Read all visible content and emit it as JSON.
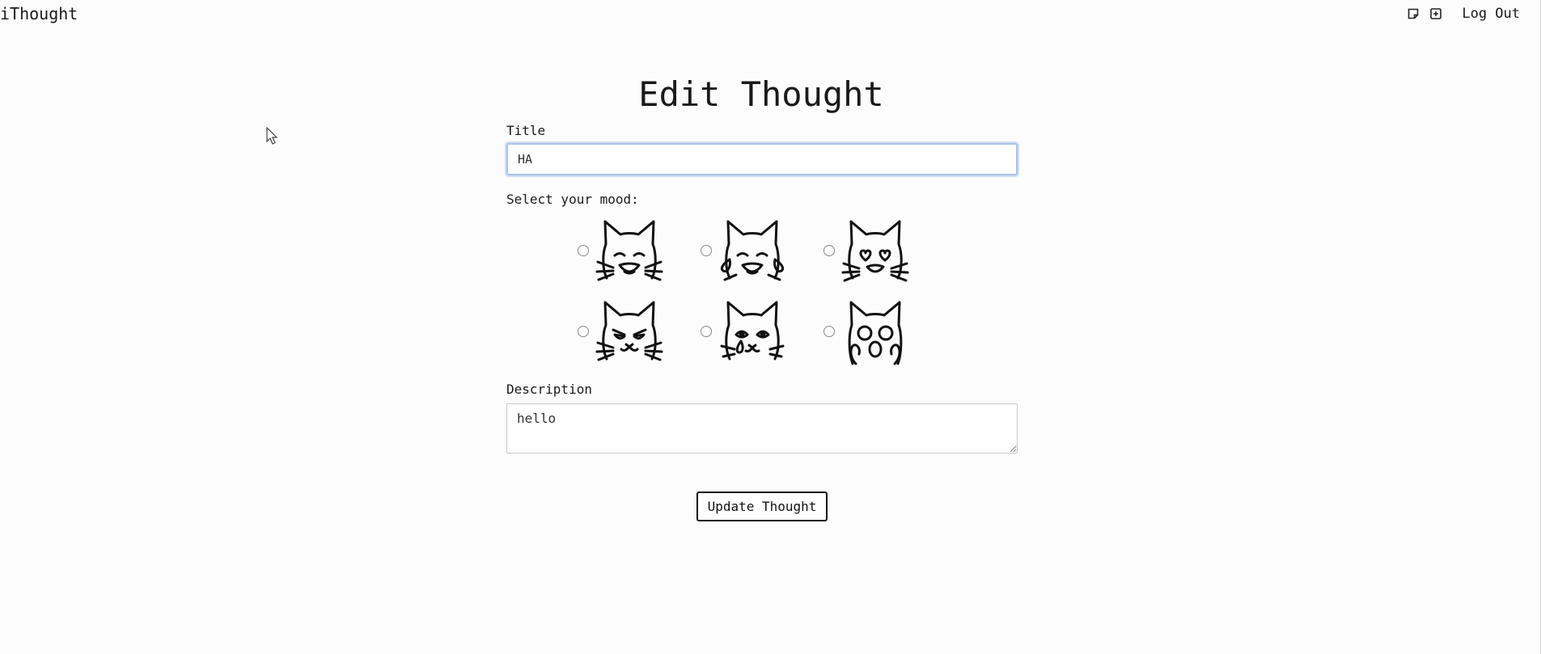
{
  "brand": "iThought",
  "nav": {
    "logout_label": "Log Out"
  },
  "page": {
    "heading": "Edit Thought"
  },
  "form": {
    "title_label": "Title",
    "title_value": "HA",
    "mood_label": "Select your mood:",
    "moods": [
      "cat-laughing-icon",
      "cat-tears-of-joy-icon",
      "cat-heart-eyes-icon",
      "cat-angry-icon",
      "cat-crying-icon",
      "cat-shocked-icon"
    ],
    "description_label": "Description",
    "description_value": "hello",
    "submit_label": "Update Thought"
  }
}
